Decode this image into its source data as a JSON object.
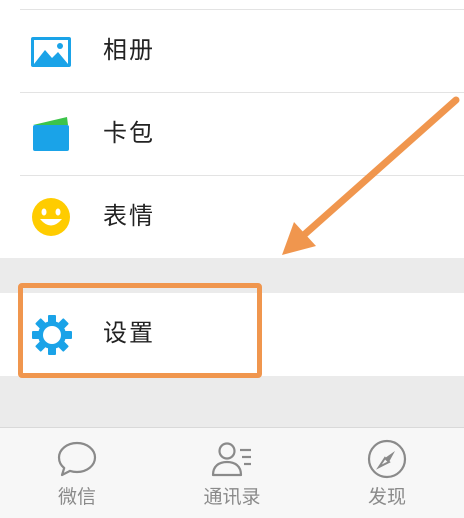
{
  "menu": {
    "items": [
      {
        "label": "相册",
        "icon": "album-icon"
      },
      {
        "label": "卡包",
        "icon": "card-wallet-icon"
      },
      {
        "label": "表情",
        "icon": "emoji-smile-icon"
      },
      {
        "label": "设置",
        "icon": "settings-gear-icon"
      }
    ]
  },
  "tabbar": {
    "tabs": [
      {
        "label": "微信",
        "icon": "chat-bubble-icon"
      },
      {
        "label": "通讯录",
        "icon": "contacts-icon"
      },
      {
        "label": "发现",
        "icon": "compass-icon"
      }
    ]
  },
  "annotation": {
    "highlight_color": "#f0964e",
    "arrow_color": "#f0964e"
  },
  "colors": {
    "accent_blue": "#1aa3e8",
    "emoji_yellow": "#ffcc00",
    "tab_icon_gray": "#8a8a8a",
    "background": "#ebebeb"
  }
}
